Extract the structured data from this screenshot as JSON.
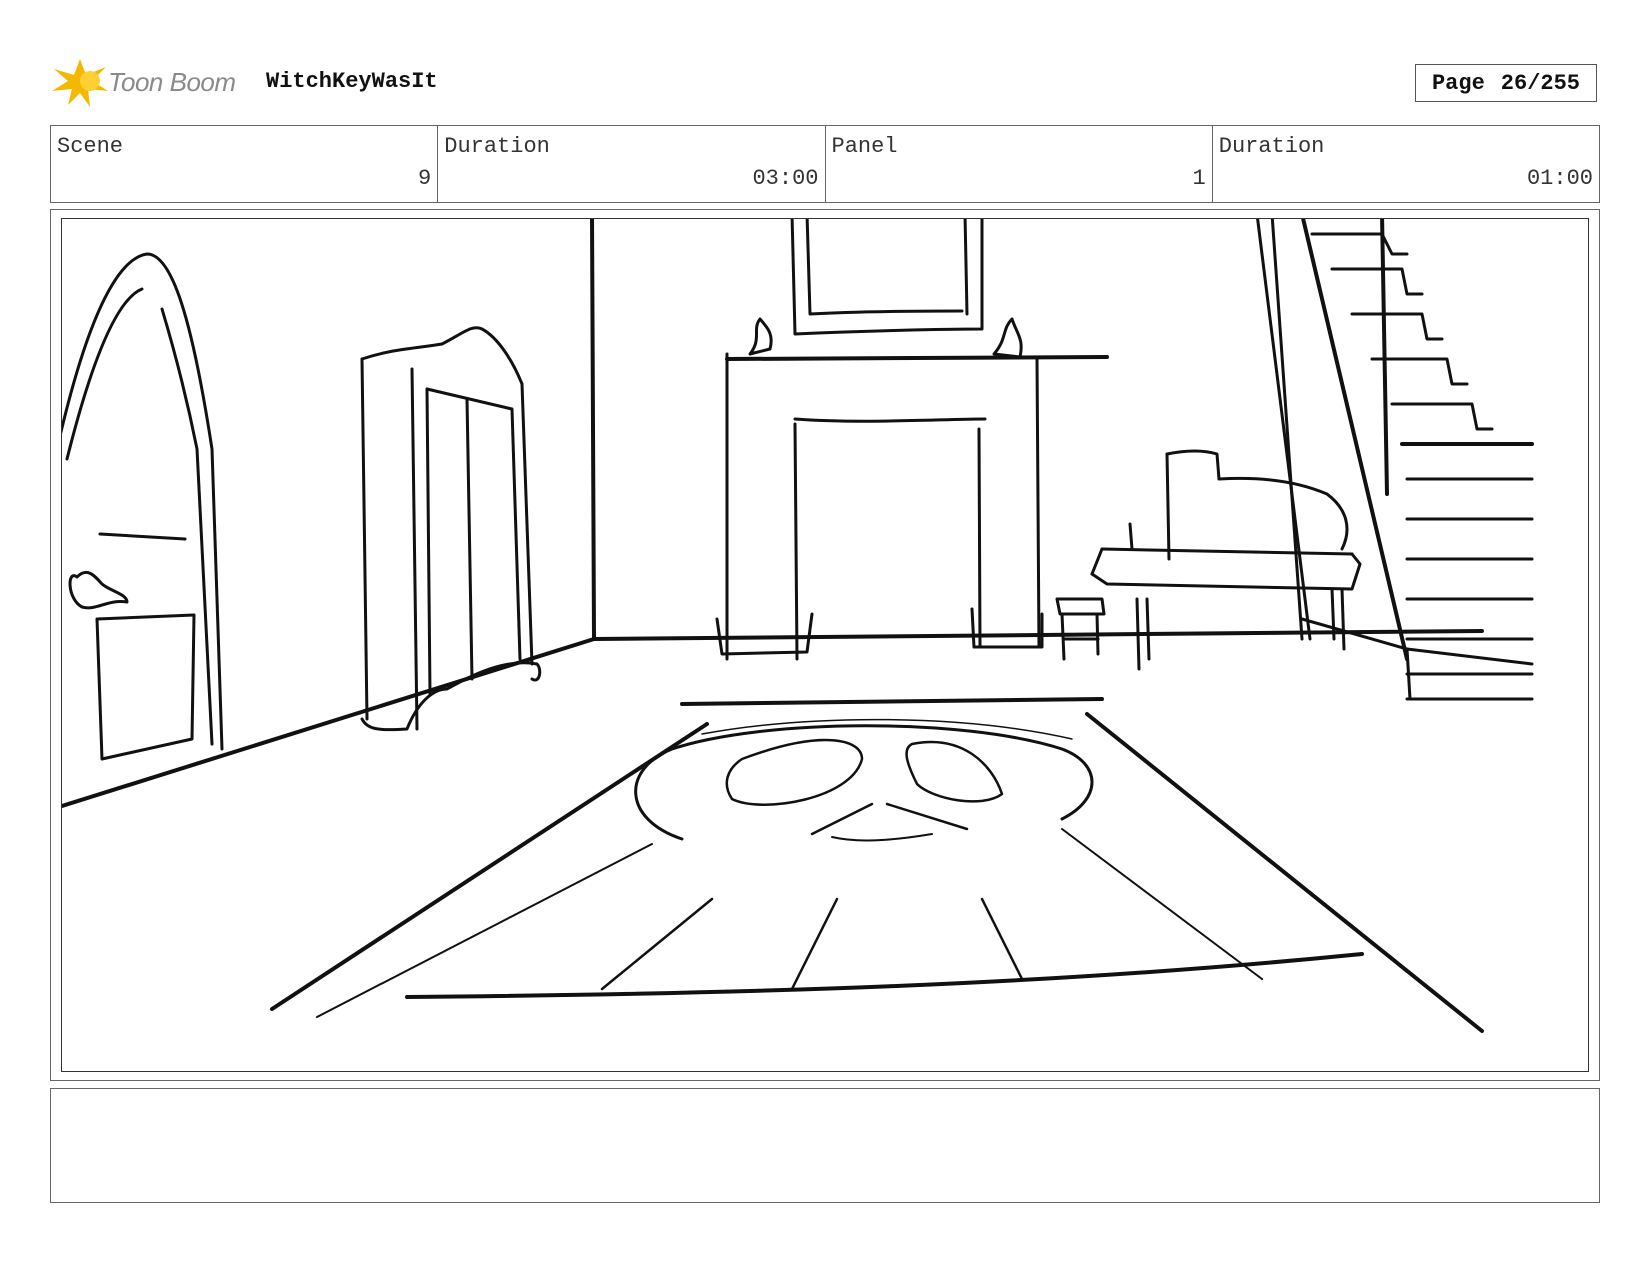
{
  "header": {
    "brand": "Toon Boom",
    "project_title": "WitchKeyWasIt",
    "page_label": "Page",
    "page_value": "26/255"
  },
  "info": {
    "scene_label": "Scene",
    "scene_value": "9",
    "scene_duration_label": "Duration",
    "scene_duration_value": "03:00",
    "panel_label": "Panel",
    "panel_value": "1",
    "panel_duration_label": "Duration",
    "panel_duration_value": "01:00"
  },
  "colors": {
    "logo_star": "#f5b800",
    "ink": "#111111"
  }
}
